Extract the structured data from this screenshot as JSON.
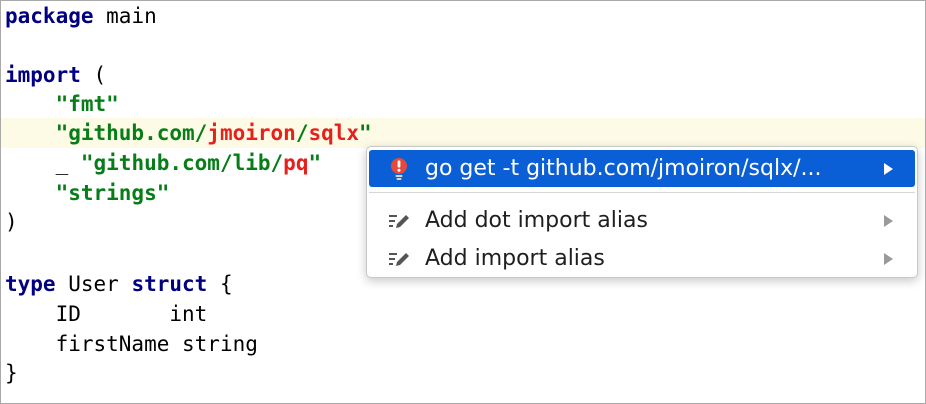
{
  "code": {
    "line1": {
      "kw": "package",
      "rest": " main"
    },
    "line3": {
      "kw": "import",
      "rest": " ("
    },
    "line4": {
      "str": "\"fmt\""
    },
    "line5": {
      "s1": "\"github.com/",
      "e1": "jmoiron",
      "s2": "/",
      "e2": "sqlx",
      "s3": "\""
    },
    "line6": {
      "blank": "_ ",
      "s1": "\"github.com/lib/",
      "e1": "pq",
      "s2": "\""
    },
    "line7": {
      "str": "\"strings\""
    },
    "line8": {
      "text": ")"
    },
    "line10": {
      "kw1": "type",
      "mid": " User ",
      "kw2": "struct",
      "rest": " {"
    },
    "line11": {
      "text": "ID       int"
    },
    "line12": {
      "text": "firstName string"
    },
    "line13": {
      "text": "}"
    }
  },
  "popup": {
    "items": [
      {
        "label": "go get -t github.com/jmoiron/sqlx/...",
        "icon": "error-bulb-icon"
      },
      {
        "label": "Add dot import alias",
        "icon": "edit-pencil-icon"
      },
      {
        "label": "Add import alias",
        "icon": "edit-pencil-icon"
      }
    ]
  },
  "colors": {
    "keyword": "#000080",
    "string": "#067d17",
    "error": "#e8201c",
    "selection": "#0a5fd6",
    "current_line": "#fdfbe6"
  }
}
